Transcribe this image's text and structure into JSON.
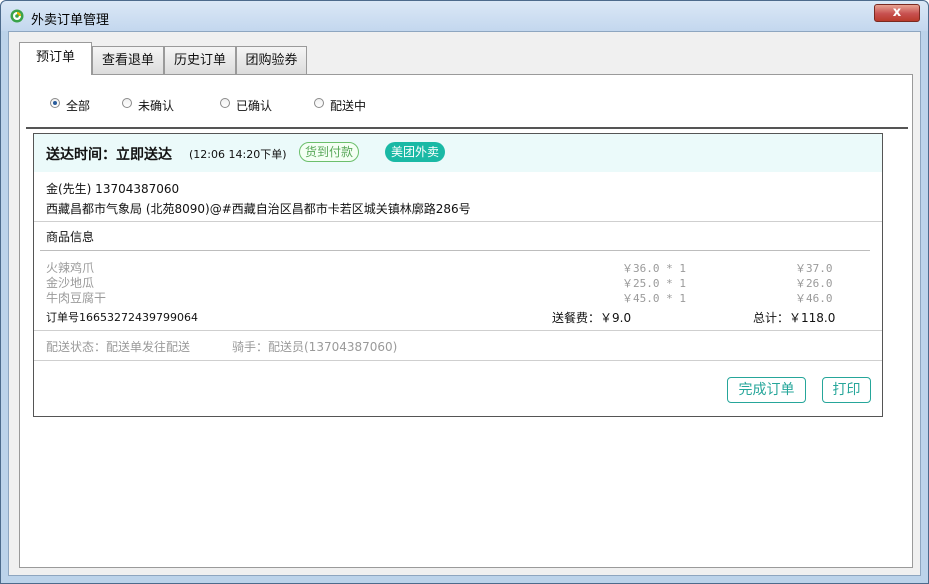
{
  "window": {
    "title": "外卖订单管理",
    "close_label": "x"
  },
  "tabs": [
    {
      "label": "预订单"
    },
    {
      "label": "查看退单"
    },
    {
      "label": "历史订单"
    },
    {
      "label": "团购验券"
    }
  ],
  "filters": {
    "selected": "全部",
    "options": [
      "全部",
      "未确认",
      "已确认",
      "配送中"
    ]
  },
  "order": {
    "deliver_label": "送达时间：立即送达",
    "deliver_time": "(12:06  14:20下单)",
    "pay_badge": "货到付款",
    "platform_badge": "美团外卖",
    "customer": "金(先生) 13704387060",
    "address": "西藏昌都市气象局 (北苑8090)@#西藏自治区昌都市卡若区城关镇林廓路286号",
    "goods_title": "商品信息",
    "items": [
      {
        "name": "火辣鸡爪",
        "unit": "￥36.0 * 1",
        "total": "￥37.0"
      },
      {
        "name": "金沙地瓜",
        "unit": "￥25.0 * 1",
        "total": "￥26.0"
      },
      {
        "name": "牛肉豆腐干",
        "unit": "￥45.0 * 1",
        "total": "￥46.0"
      }
    ],
    "order_no": "订单号16653272439799064",
    "delivery_fee": "送餐费：￥9.0",
    "grand_total": "总计：￥118.0",
    "delivery_status": "配送状态：配送单发往配送",
    "rider": "骑手：配送员(13704387060)",
    "complete_button": "完成订单",
    "print_button": "打印"
  },
  "colors": {
    "accent": "#1ab9a5",
    "pay_green": "#59a859",
    "header_bg": "#ebfafa"
  }
}
